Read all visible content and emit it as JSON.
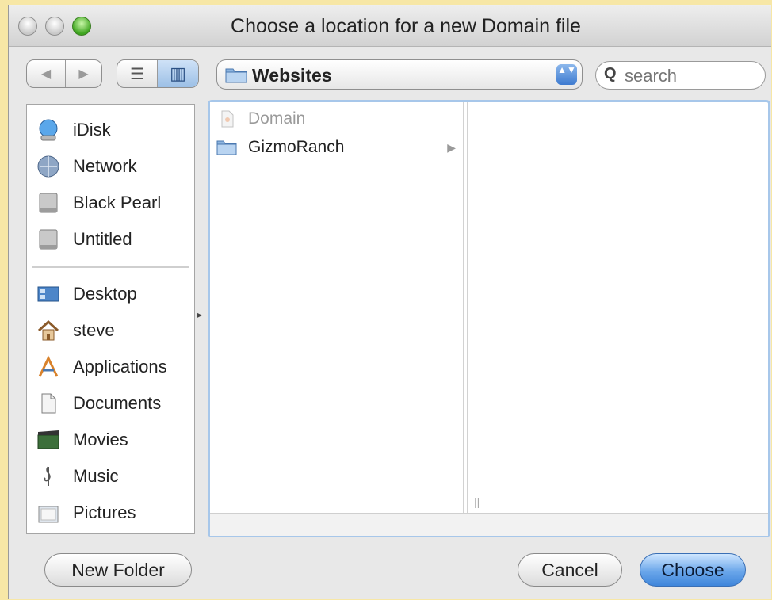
{
  "window": {
    "title": "Choose a location for a new Domain file"
  },
  "toolbar": {
    "back_icon": "◀",
    "forward_icon": "▶",
    "list_view_icon": "☰",
    "column_view_icon": "▥",
    "location": "Websites",
    "stepper_icon": "▲▼",
    "search_placeholder": "search",
    "search_icon": "Q"
  },
  "sidebar": {
    "devices": [
      {
        "label": "iDisk",
        "icon": "idisk-icon"
      },
      {
        "label": "Network",
        "icon": "network-icon"
      },
      {
        "label": "Black Pearl",
        "icon": "hard-drive-icon"
      },
      {
        "label": "Untitled",
        "icon": "hard-drive-icon"
      }
    ],
    "places": [
      {
        "label": "Desktop",
        "icon": "desktop-icon"
      },
      {
        "label": "steve",
        "icon": "home-icon"
      },
      {
        "label": "Applications",
        "icon": "applications-icon"
      },
      {
        "label": "Documents",
        "icon": "documents-icon"
      },
      {
        "label": "Movies",
        "icon": "movies-icon"
      },
      {
        "label": "Music",
        "icon": "music-icon"
      },
      {
        "label": "Pictures",
        "icon": "pictures-icon"
      }
    ]
  },
  "browser": {
    "column1": [
      {
        "label": "Domain",
        "dimmed": true
      },
      {
        "label": "GizmoRanch",
        "has_arrow": true,
        "arrow": "▶"
      }
    ],
    "resize_mark": "||",
    "collapse_mark": "▸"
  },
  "buttons": {
    "new_folder": "New Folder",
    "cancel": "Cancel",
    "choose": "Choose"
  },
  "colors": {
    "background": "#f7e7a6",
    "accent": "#3e7bd0",
    "focus_ring": "#a7c7ea"
  }
}
